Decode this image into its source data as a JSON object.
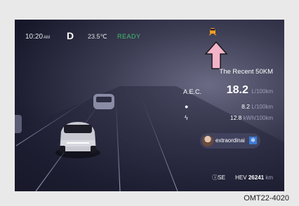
{
  "status": {
    "time": "10:20",
    "time_suffix": "AM",
    "gear": "D",
    "temperature": "23.5℃",
    "ready": "READY"
  },
  "panel": {
    "title": "The Recent 50KM",
    "aec_label": "A.E.C.",
    "aec_value": "18.2",
    "aec_unit": "L/100km",
    "fuel_value": "8.2",
    "fuel_unit": "L/100km",
    "electric_value": "12.8",
    "electric_unit": "kWh/100km"
  },
  "profile": {
    "name": "extraordinai"
  },
  "footer": {
    "mode": "SE",
    "odo_label": "HEV",
    "odo_value": "26241",
    "odo_unit": "km"
  },
  "figure_code": "OMT22-4020",
  "colors": {
    "ready": "#3fbf6a",
    "arrow": "#f3b3c8",
    "warning_icon": "#f0a020"
  }
}
